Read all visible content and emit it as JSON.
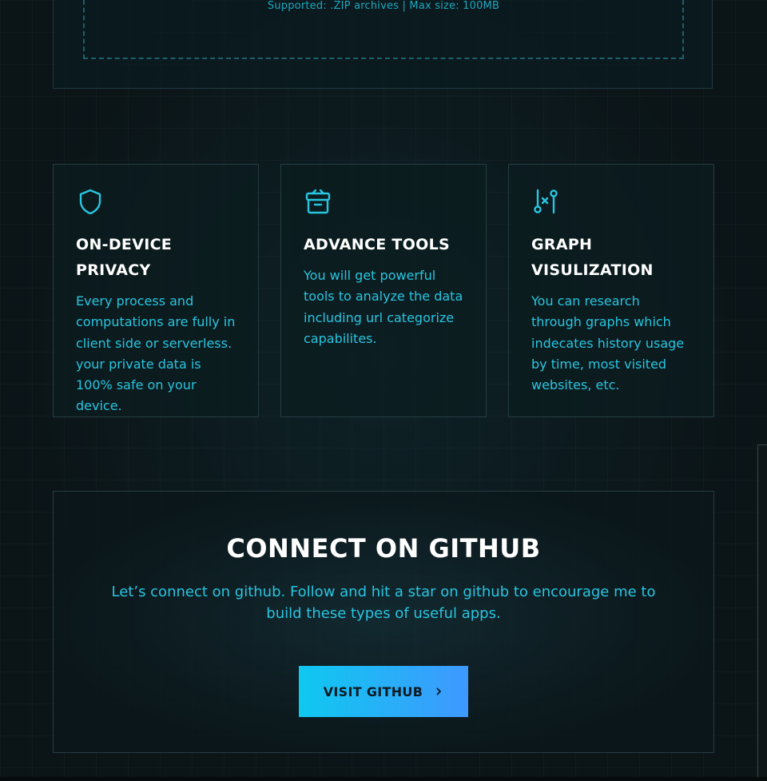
{
  "upload": {
    "supported_text": "Supported: .ZIP archives | Max size: 100MB"
  },
  "features": [
    {
      "icon": "shield-icon",
      "title": "ON-DEVICE PRIVACY",
      "description": "Every process and computations are fully in client side or serverless. your private data is 100% safe on your device."
    },
    {
      "icon": "archive-box-icon",
      "title": "ADVANCE TOOLS",
      "description": "You will get powerful tools to analyze the data including url categorize capabilites."
    },
    {
      "icon": "git-compare-icon",
      "title": "GRAPH VISULIZATION",
      "description": "You can research through graphs which indecates history usage by time, most visited websites, etc."
    }
  ],
  "cta": {
    "title": "CONNECT ON GITHUB",
    "description": "Let’s connect on github. Follow and hit a star on github to encourage me to build these types of useful apps.",
    "button_label": "VISIT GITHUB"
  },
  "colors": {
    "accent": "#28c5e0",
    "button_gradient_start": "#0fc8f0",
    "button_gradient_end": "#3f98ff",
    "background": "#0b1417"
  }
}
